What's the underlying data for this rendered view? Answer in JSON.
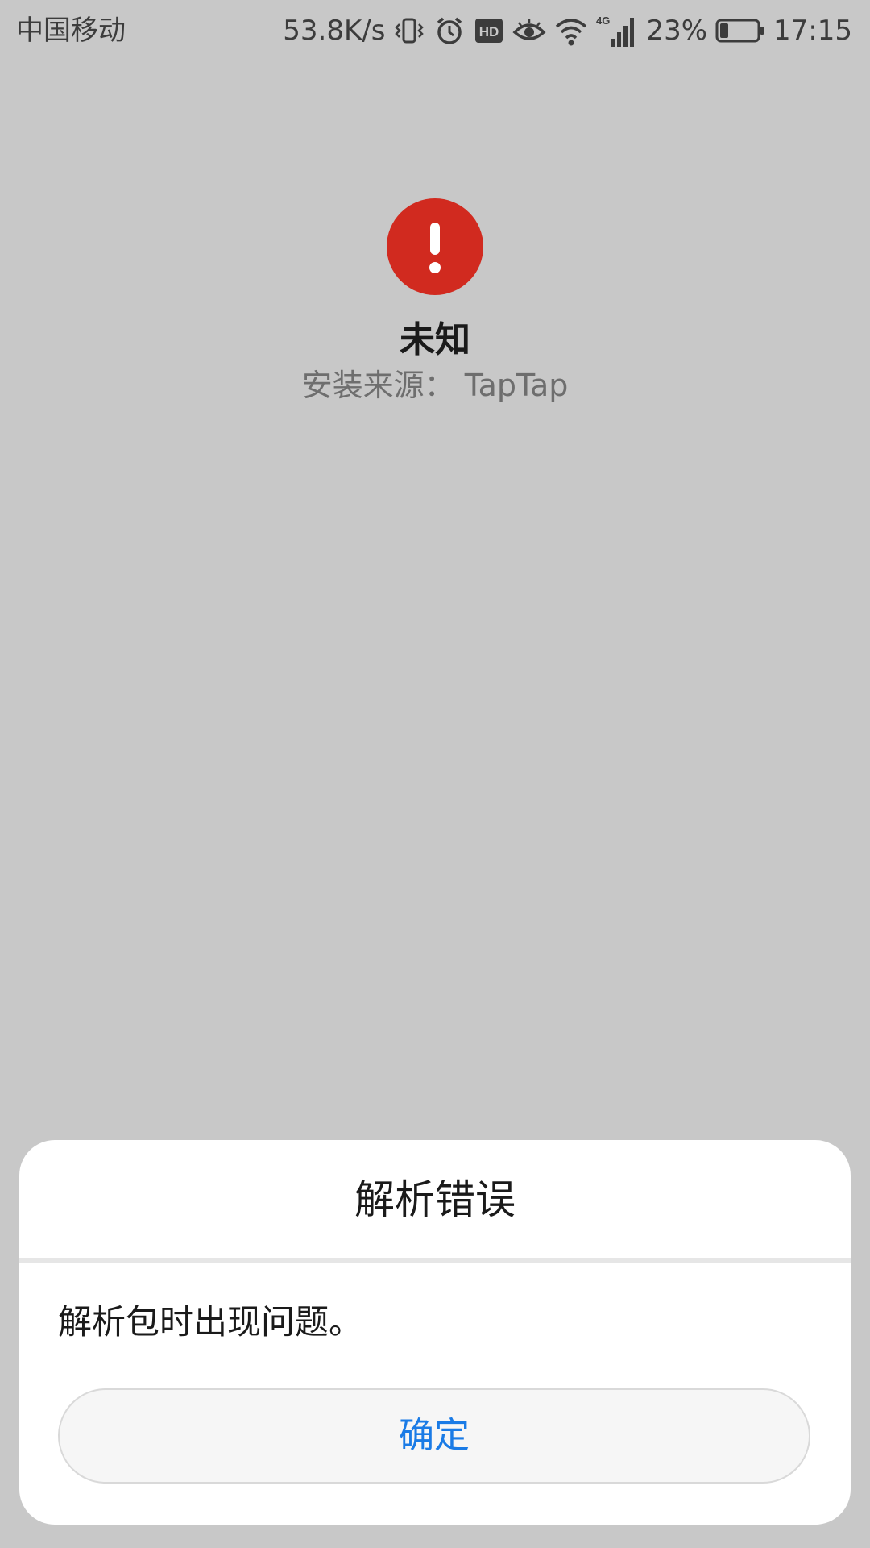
{
  "status_bar": {
    "carrier": "中国移动",
    "network_speed": "53.8K/s",
    "battery_percent": "23%",
    "battery_level": 0.23,
    "time": "17:15",
    "icons": [
      "vibrate-icon",
      "alarm-icon",
      "hd-icon",
      "eye-icon",
      "wifi-icon",
      "4g-signal-icon",
      "battery-icon"
    ],
    "hd_label": "HD",
    "network_type": "4G"
  },
  "app": {
    "icon": "error-exclamation-icon",
    "icon_color": "#d12a1f",
    "name": "未知",
    "install_source": "安装来源： TapTap"
  },
  "dialog": {
    "title": "解析错误",
    "message": "解析包时出现问题。",
    "confirm_label": "确定",
    "accent_color": "#1a7be6"
  }
}
